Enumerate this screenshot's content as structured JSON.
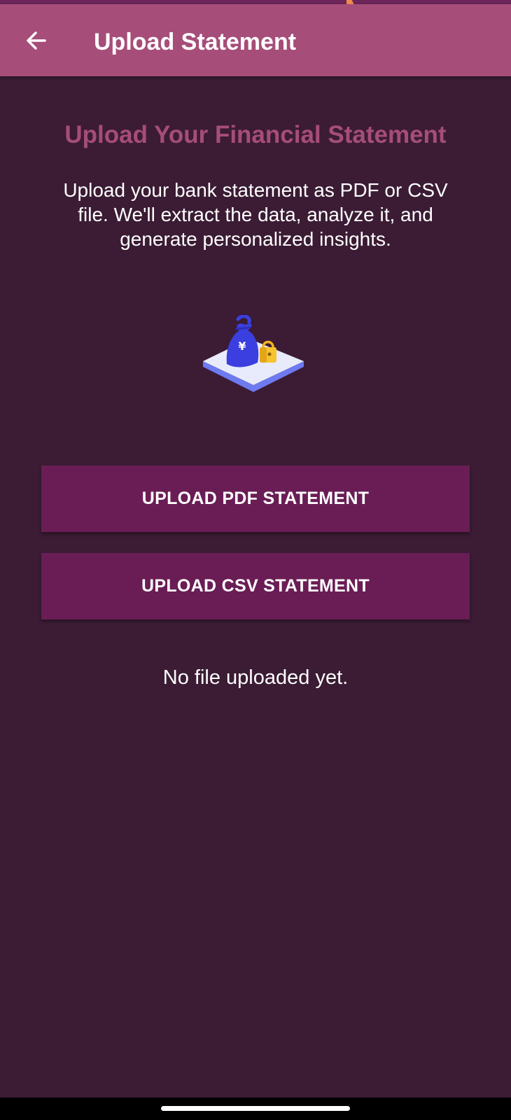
{
  "app_bar": {
    "title": "Upload Statement",
    "back_icon": "arrow-left-icon",
    "background": "#a64d79"
  },
  "main": {
    "heading": "Upload Your Financial Statement",
    "description": "Upload your bank statement as PDF or CSV file. We'll extract the data, analyze it, and generate personalized insights.",
    "illustration_icon": "money-bag-lock-icon",
    "buttons": {
      "upload_pdf": "UPLOAD PDF STATEMENT",
      "upload_csv": "UPLOAD CSV STATEMENT"
    },
    "status": "No file uploaded yet."
  },
  "colors": {
    "background": "#3b1c34",
    "accent": "#a64d79",
    "button": "#6a1d55"
  }
}
